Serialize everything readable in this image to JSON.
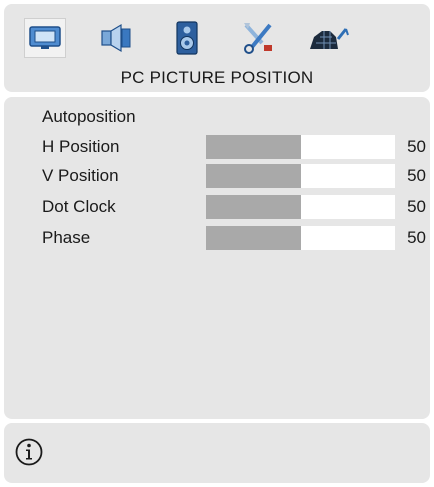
{
  "header": {
    "tabs": [
      {
        "name": "picture",
        "icon": "monitor-icon",
        "active": true
      },
      {
        "name": "sound",
        "icon": "speaker-icon",
        "active": false
      },
      {
        "name": "audio-output",
        "icon": "loudspeaker-box-icon",
        "active": false
      },
      {
        "name": "features",
        "icon": "tools-icon",
        "active": false
      },
      {
        "name": "install",
        "icon": "antenna-dish-icon",
        "active": false
      }
    ],
    "title": "PC PICTURE POSITION"
  },
  "menu": {
    "items": [
      {
        "label": "Autoposition"
      },
      {
        "label": "H Position",
        "value": "50",
        "level": 0.5
      },
      {
        "label": "V Position",
        "value": "50",
        "level": 0.5
      },
      {
        "label": "Dot Clock",
        "value": "50",
        "level": 0.5
      },
      {
        "label": "Phase",
        "value": "50",
        "level": 0.5
      }
    ]
  },
  "footer": {
    "icon": "info-icon"
  },
  "colors": {
    "panel": "#e6e6e6",
    "bar_fill": "#a9a9a9",
    "bar_track": "#ffffff",
    "icon_blue": "#2f6fb5"
  }
}
